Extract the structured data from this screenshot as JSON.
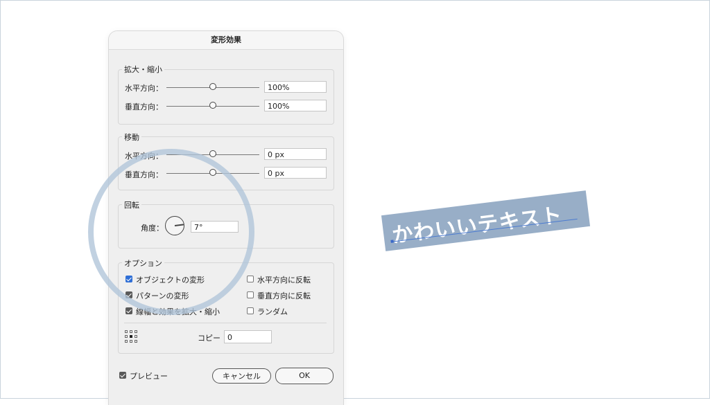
{
  "dialog": {
    "title": "変形効果",
    "scale": {
      "title": "拡大・縮小",
      "horizontal_label": "水平方向：",
      "horizontal_value": "100%",
      "vertical_label": "垂直方向：",
      "vertical_value": "100%"
    },
    "move": {
      "title": "移動",
      "horizontal_label": "水平方向：",
      "horizontal_value": "0 px",
      "vertical_label": "垂直方向：",
      "vertical_value": "0 px"
    },
    "rotate": {
      "title": "回転",
      "angle_label": "角度：",
      "angle_value": "7°"
    },
    "options": {
      "title": "オプション",
      "transform_objects": "オブジェクトの変形",
      "transform_patterns": "パターンの変形",
      "scale_strokes": "線幅と効果を拡大・縮小",
      "reflect_x": "水平方向に反転",
      "reflect_y": "垂直方向に反転",
      "random": "ランダム",
      "copies_label": "コピー",
      "copies_value": "0"
    },
    "preview_label": "プレビュー",
    "cancel_label": "キャンセル",
    "ok_label": "OK"
  },
  "canvas": {
    "art_text": "かわいいテキスト",
    "art_fill": "#98aec7",
    "highlight_color": "#b0c4d8"
  }
}
